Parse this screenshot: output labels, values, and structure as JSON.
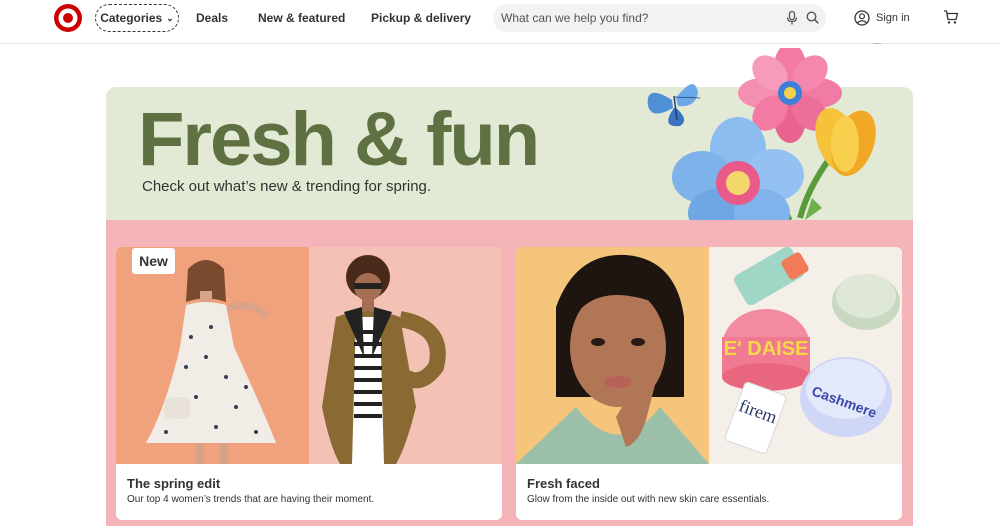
{
  "header": {
    "logo_icon": "target-bullseye-icon",
    "categories_label": "Categories",
    "nav": [
      "Deals",
      "New & featured",
      "Pickup & delivery"
    ],
    "search_placeholder": "What can we help you find?",
    "signin_label": "Sign in",
    "brand_color": "#cc0000"
  },
  "banner": {
    "headline": "Fresh & fun",
    "subline": "Check out what’s new & trending for spring.",
    "bg_color": "#e2e9d4",
    "headline_color": "#5f7143"
  },
  "section_bg": "#f4b4b8",
  "cards": [
    {
      "badge": "New",
      "title": "The spring edit",
      "desc": "Our top 4 women’s trends that are having their moment."
    },
    {
      "title": "Fresh faced",
      "desc": "Glow from the inside out with new skin care essentials."
    }
  ],
  "product_labels": {
    "jar_pink": "E' DAISE",
    "jar_blue": "Cashmere",
    "tube": "firem"
  }
}
